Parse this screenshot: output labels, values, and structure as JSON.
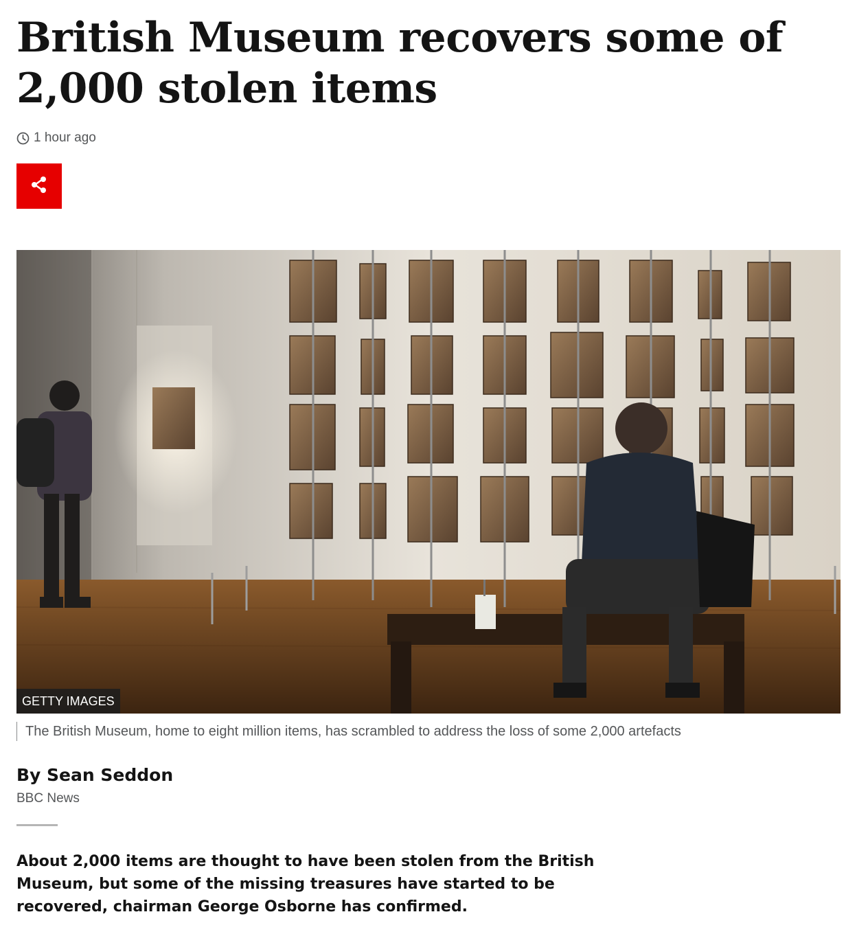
{
  "article": {
    "headline": "British Museum recovers some of 2,000 stolen items",
    "timestamp": "1 hour ago",
    "image": {
      "credit": "GETTY IMAGES",
      "caption": "The British Museum, home to eight million items, has scrambled to address the loss of some 2,000 artefacts"
    },
    "byline": {
      "name": "By Sean Seddon",
      "organisation": "BBC News"
    },
    "intro": "About 2,000 items are thought to have been stolen from the British Museum, but some of the missing treasures have started to be recovered, chairman George Osborne has confirmed."
  },
  "icons": {
    "clock": "clock-icon",
    "share": "share-icon"
  },
  "colors": {
    "share_button": "#e60000",
    "text": "#141414",
    "muted": "#545658"
  }
}
